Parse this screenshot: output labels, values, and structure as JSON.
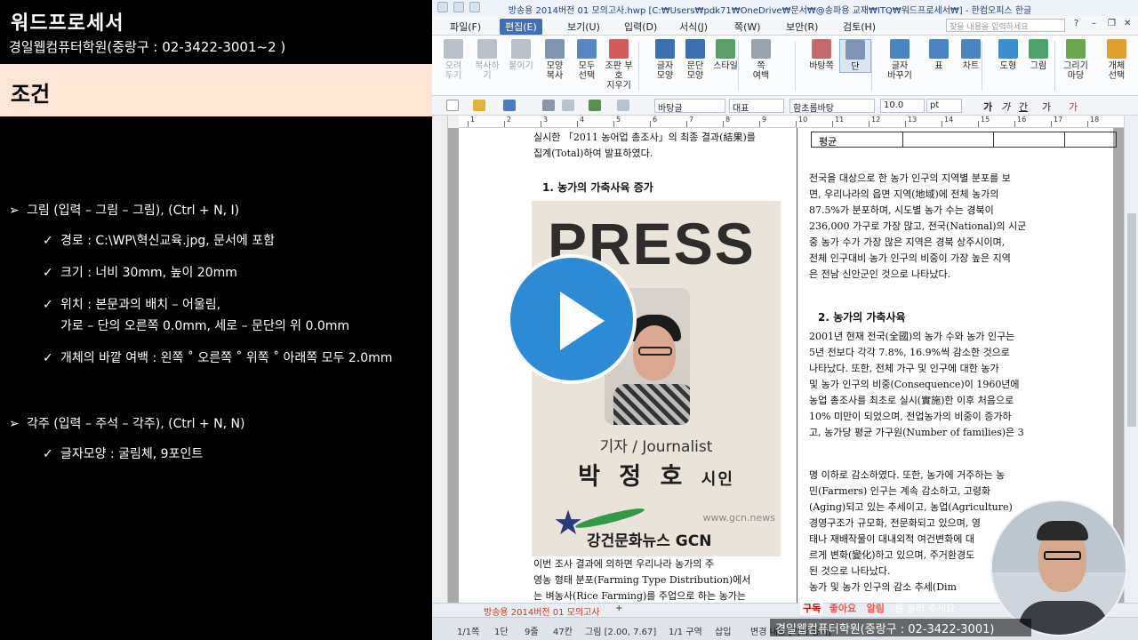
{
  "left": {
    "brand_title": "워드프로세서",
    "brand_sub": "경일웹컴퓨터학원(중랑구 : 02-3422-3001~2 )",
    "cond_title": "조건",
    "bullet": "➢",
    "check": "✓",
    "items": [
      {
        "main": "그림 (입력 – 그림 – 그림), (Ctrl + N, I)",
        "subs": [
          "경로 : C:\\WP\\혁신교육.jpg, 문서에 포함",
          "크기 : 너비 30mm, 높이 20mm",
          "위치 : 본문과의 배치 – 어울림,",
          "개체의 바깥 여백 : 왼쪽 ˚ 오른쪽 ˚ 위쪽 ˚ 아래쪽 모두 2.0mm"
        ],
        "cont": "가로 – 단의 오른쪽 0.0mm, 세로 – 문단의 위 0.0mm"
      },
      {
        "main": "각주 (입력 – 주석 – 각주), (Ctrl + N, N)",
        "subs": [
          "글자모양 : 굴림체, 9포인트"
        ]
      }
    ]
  },
  "window": {
    "title": "방송용 2014버전 01 모의고사.hwp [C:₩Users₩pdk71₩OneDrive₩문서₩@송파용 교재₩ITQ₩워드프로세서₩] - 한컴오피스 한글",
    "menus": [
      "파일(F)",
      "편집(E)",
      "보기(U)",
      "입력(D)",
      "서식(J)",
      "쪽(W)",
      "보안(R)",
      "검토(H)"
    ],
    "active_menu": "편집(E)",
    "help_placeholder": "찾을 내용을 입력하세요",
    "ribbon": [
      {
        "label": "오려\n두기",
        "dim": true,
        "color": "#b9c0c8"
      },
      {
        "label": "복사하기",
        "dim": true,
        "color": "#b9c0c8"
      },
      {
        "label": "붙이기",
        "dim": true,
        "color": "#b9c0c8"
      },
      {
        "label": "모양\n복사",
        "dim": false,
        "color": "#7f93b3"
      },
      {
        "label": "모두\n선택",
        "dim": false,
        "color": "#5b86c5"
      },
      {
        "label": "조판 부호\n지우기",
        "dim": false,
        "color": "#d35a5a"
      },
      {
        "label": "글자\n모양",
        "dim": false,
        "color": "#3c6fb0"
      },
      {
        "label": "문단\n모양",
        "dim": false,
        "color": "#3c6fb0"
      },
      {
        "label": "스타일",
        "dim": false,
        "color": "#5aa06a"
      },
      {
        "label": "쪽\n여백",
        "dim": false,
        "color": "#9aa3ad"
      },
      {
        "label": "바탕쪽",
        "dim": false,
        "color": "#c46a6a"
      },
      {
        "label": "단",
        "dim": false,
        "color": "#7f93b3"
      },
      {
        "label": "글자\n바꾸기",
        "dim": false,
        "color": "#4b83c4"
      },
      {
        "label": "표",
        "dim": false,
        "color": "#4b83c4"
      },
      {
        "label": "차트",
        "dim": false,
        "color": "#4b83c4"
      },
      {
        "label": "도형",
        "dim": false,
        "color": "#3a8fd0"
      },
      {
        "label": "그림",
        "dim": false,
        "color": "#4fa36a"
      },
      {
        "label": "그리기마당",
        "dim": false,
        "color": "#6aa84f"
      },
      {
        "label": "개체\n선택",
        "dim": false,
        "color": "#e0a030"
      }
    ],
    "toolbar": {
      "style": "바탕글",
      "lang": "대표",
      "font": "함초롬바탕",
      "size": "10.0",
      "unit": "pt",
      "b": "가",
      "i": "가",
      "u": "간",
      "s": "가",
      "c": "가"
    },
    "ruler_numbers": [
      "1",
      "2",
      "3",
      "4",
      "5",
      "6",
      "7",
      "8",
      "9",
      "10",
      "11",
      "12",
      "13",
      "14",
      "15",
      "16",
      "17",
      "18"
    ],
    "tab_name": "방송용 2014버전 01 모의고사",
    "tab_plus": "+",
    "status": [
      "1/1쪽",
      "1단",
      "9줄",
      "47칸",
      "그림 [2.00, 7.67]",
      "1/1 구역",
      "삽입",
      "변경 내용 [기록 중지]"
    ]
  },
  "document": {
    "left_col": {
      "intro": [
        "실시한 「2011 농어업 총조사」의 최종 결과(結果)를",
        "집계(Total)하여 발표하였다."
      ],
      "heading1": "1. 농가의 가축사육 증가",
      "press": {
        "word": "PRESS",
        "role": "기자 / Journalist",
        "name": "박 정 호",
        "suffix": "시인",
        "url": "www.gcn.news",
        "org": "강건문화뉴스 GCN",
        "star": "★"
      },
      "after": [
        "이번 조사 결과에 의하면 우리나라 농가의 주",
        "영농 형태 분포(Farming Type Distribution)에서",
        "는 벼농사(Rice Farming)를 주업으로 하는 농가는"
      ]
    },
    "right_col": {
      "table_label": "평균",
      "para1": [
        "전국을 대상으로 한 농가 인구의 지역별 분포를 보",
        "면, 우리나라의 읍면 지역(地域)에 전체 농가의",
        "87.5%가 분포하며, 시도별 농가 수는 경북이",
        "236,000 가구로 가장 많고, 전국(National)의 시군",
        "중 농가 수가 가장 많은 지역은 경북 상주시이며,",
        "전체 인구대비 농가 인구의 비중이 가장 높은 지역",
        "은 전남 신안군인 것으로 나타났다."
      ],
      "heading2": "2. 농가의 가축사육",
      "para2": [
        "2001년 현재 전국(全國)의 농가 수와 농가 인구는",
        "5년 전보다 각각 7.8%, 16.9%씩 감소한 것으로",
        "나타났다. 또한, 전체 가구 및 인구에 대한 농가",
        "및 농가 인구의 비중(Consequence)이 1960년에",
        "농업 총조사를 최초로 실시(實施)한 이후 처음으로",
        "10% 미만이 되었으며, 전업농가의 비중이 증가하",
        "고, 농가당 평균 가구원(Number of families)은 3"
      ],
      "para3": [
        "명 이하로 감소하였다. 또한, 농가에 거주하는 농",
        "민(Farmers) 인구는 계속 감소하고, 고령화",
        "(Aging)되고 있는 추세이고, 농업(Agriculture)",
        "경영구조가 규모화, 전문화되고 있으며, 영",
        "태나 재배작물이 대내외적 여건변화에 대",
        "르게 변화(變化)하고 있으며, 주거환경도",
        "된 것으로 나타났다.",
        "농가 및 농가 인구의 감소 추세(Dim"
      ]
    }
  },
  "overlay": {
    "caption": "경일웹컴퓨터학원(중랑구 : 02-3422-3001)",
    "check_label": "구독",
    "like_label": "좋아요",
    "bell_label": "알림",
    "extra": "를 눌러 주세요"
  }
}
